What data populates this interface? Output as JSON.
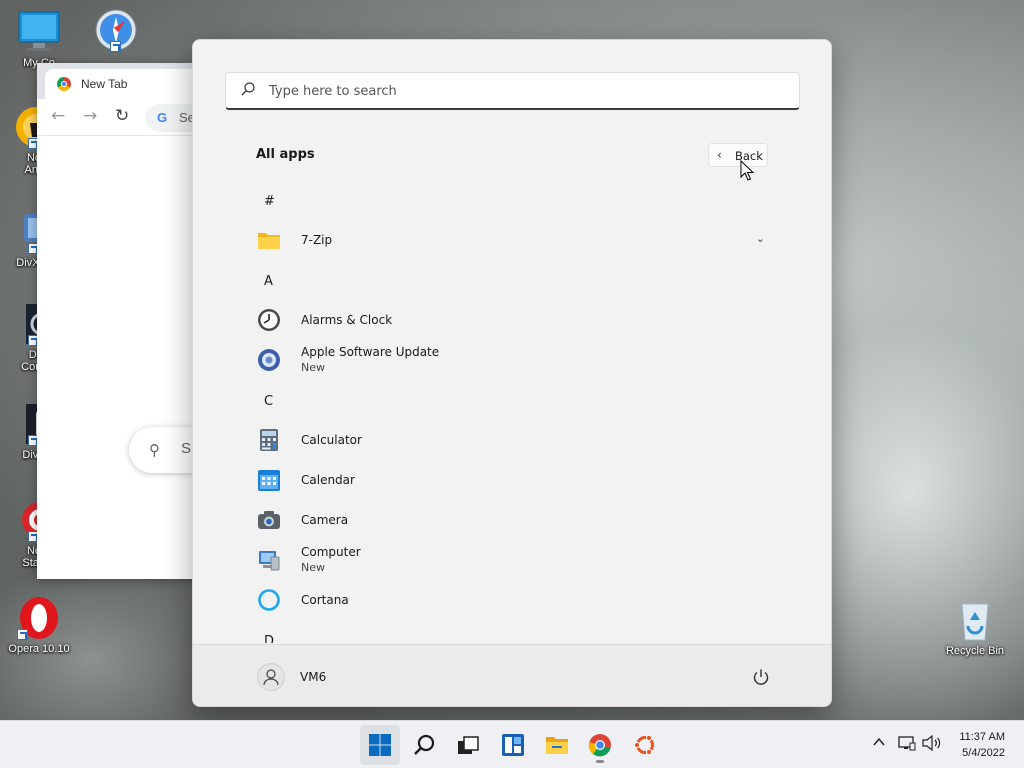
{
  "desktop": {
    "icons": [
      {
        "name": "my-computer",
        "label": "My Co",
        "icon": "monitor-icon"
      },
      {
        "name": "safari",
        "label": "",
        "icon": "safari-icon"
      },
      {
        "name": "norton",
        "label": "No\nAnti",
        "icon": "norton-icon"
      },
      {
        "name": "divx-media",
        "label": "DivX M",
        "icon": "divx-icon"
      },
      {
        "name": "divx-converter",
        "label": "Di\nConv",
        "icon": "divx-converter-icon"
      },
      {
        "name": "divx-player",
        "label": "DivX",
        "icon": "divx-player-icon"
      },
      {
        "name": "nero-start",
        "label": "Ne\nStart",
        "icon": "nero-icon"
      },
      {
        "name": "opera",
        "label": "Opera 10.10",
        "icon": "opera-icon"
      },
      {
        "name": "recycle-bin",
        "label": "Recycle Bin",
        "icon": "recycle-bin-icon"
      }
    ]
  },
  "chrome": {
    "tab_title": "New Tab",
    "omnibox_text": "Se",
    "google_logo": "G",
    "search_text": "S"
  },
  "start_menu": {
    "search_placeholder": "Type here to search",
    "heading": "All apps",
    "back_label": "Back",
    "groups": [
      {
        "letter": "#",
        "apps": [
          {
            "name": "7-Zip",
            "sub": "",
            "icon": "folder-icon",
            "expandable": true
          }
        ]
      },
      {
        "letter": "A",
        "apps": [
          {
            "name": "Alarms & Clock",
            "sub": "",
            "icon": "alarm-clock-icon"
          },
          {
            "name": "Apple Software Update",
            "sub": "New",
            "icon": "apple-update-icon"
          }
        ]
      },
      {
        "letter": "C",
        "apps": [
          {
            "name": "Calculator",
            "sub": "",
            "icon": "calculator-icon"
          },
          {
            "name": "Calendar",
            "sub": "",
            "icon": "calendar-icon"
          },
          {
            "name": "Camera",
            "sub": "",
            "icon": "camera-icon"
          },
          {
            "name": "Computer",
            "sub": "New",
            "icon": "computer-icon"
          },
          {
            "name": "Cortana",
            "sub": "",
            "icon": "cortana-icon"
          }
        ]
      },
      {
        "letter": "D",
        "apps": []
      }
    ],
    "user": "VM6"
  },
  "taskbar": {
    "items": [
      "start",
      "search",
      "task-view",
      "widgets",
      "file-explorer",
      "chrome",
      "ubuntu"
    ],
    "time": "11:37 AM",
    "date": "5/4/2022"
  },
  "colors": {
    "accent": "#0a6cc1",
    "start_bg": "#f2f2f2",
    "taskbar_bg": "#eef0f3"
  }
}
